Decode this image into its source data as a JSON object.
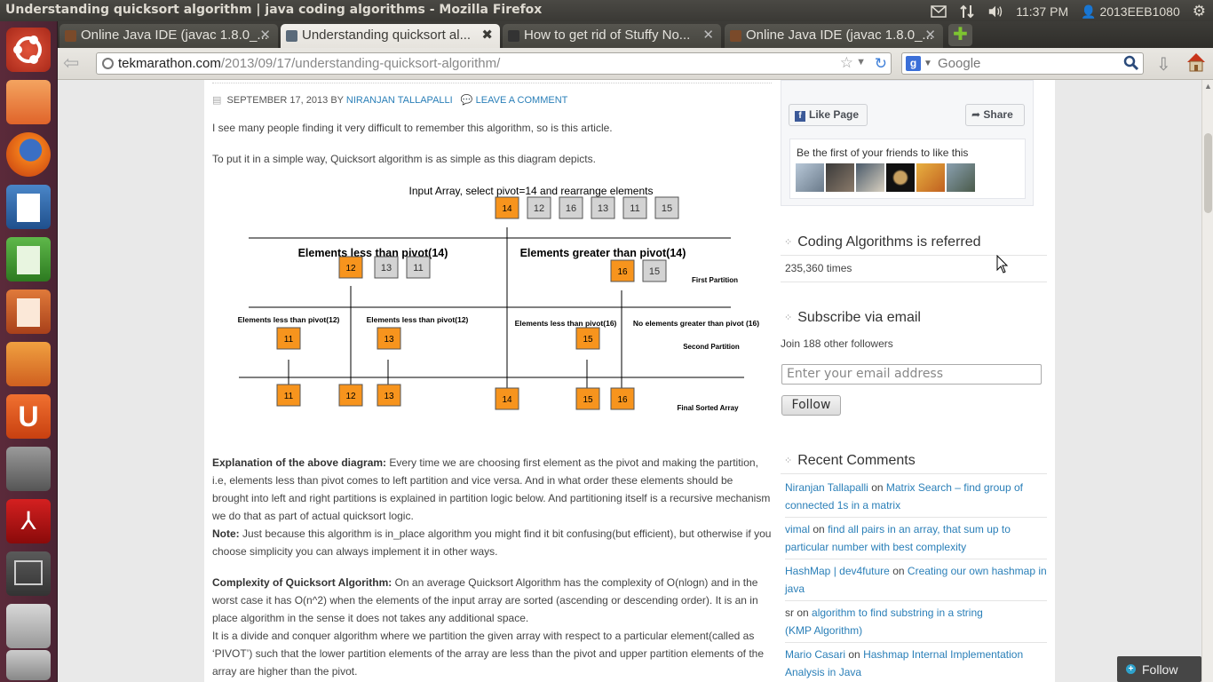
{
  "window": {
    "title": "Understanding quicksort algorithm | java coding algorithms - Mozilla Firefox"
  },
  "tray": {
    "time": "11:37 PM",
    "user": "2013EEB1080"
  },
  "tabs": [
    {
      "label": "Online Java IDE (javac 1.8.0_..."
    },
    {
      "label": "Understanding quicksort al..."
    },
    {
      "label": "How to get rid of Stuffy No..."
    },
    {
      "label": "Online Java IDE (javac 1.8.0_..."
    }
  ],
  "navbar": {
    "url_host": "tekmarathon.com",
    "url_path": "/2013/09/17/understanding-quicksort-algorithm/",
    "search_placeholder": "Google",
    "search_engine_letter": "g"
  },
  "article": {
    "date": "SEPTEMBER 17, 2013",
    "by": "BY",
    "author": "NIRANJAN TALLAPALLI",
    "comment_link": "LEAVE A COMMENT",
    "intro1": "I see many people finding it very difficult to remember this algorithm, so is this article.",
    "intro2": "To put it in a simple way, Quicksort algorithm is as simple as this diagram depicts.",
    "explanation_label": "Explanation of the above diagram:",
    "explanation_text": " Every time we are choosing first element as the pivot and making the partition, i.e, elements less than pivot comes to left partition and vice versa. And in what order these elements should be brought into left and right partitions is explained in partition logic below. And partitioning itself is a recursive mechanism we do that as part of actual quicksort logic.",
    "note_label": "Note:",
    "note_text": " Just because this algorithm is in_place algorithm you might find it bit confusing(but efficient), but otherwise if you choose simplicity you can always implement it in other ways.",
    "complexity_label": "Complexity of Quicksort Algorithm:",
    "complexity_text": " On an average Quicksort Algorithm has the complexity of O(nlogn) and in the worst case it has O(n^2) when the elements of the input array are sorted (ascending or descending order). It is an in place algorithm in the sense it does not takes any additional space.",
    "divide_text": "It is a divide and conquer algorithm where we partition the given array with respect to a particular element(called as ‘PIVOT’) such that the lower partition elements of the array are less than the pivot and upper partition elements of the array are higher than the pivot."
  },
  "diagram": {
    "title": "Input Array, select pivot=14 and rearrange elements",
    "input": [
      "14",
      "12",
      "16",
      "13",
      "11",
      "15"
    ],
    "less14": "Elements less than pivot(14)",
    "greater14": "Elements greater than pivot(14)",
    "left1": [
      "12",
      "13",
      "11"
    ],
    "right1": [
      "16",
      "15"
    ],
    "first_partition": "First Partition",
    "less12a": "Elements less than pivot(12)",
    "less12b": "Elements less than pivot(12)",
    "less16": "Elements less than pivot(16)",
    "nogreater16": "No elements greater than pivot (16)",
    "second": [
      "11",
      "13",
      "15"
    ],
    "second_partition": "Second Partition",
    "final": [
      "11",
      "12",
      "13",
      "14",
      "15",
      "16"
    ],
    "final_label": "Final Sorted Array",
    "colors": {
      "pivot": "#f7941d",
      "other": "#d3d3d3"
    }
  },
  "sidebar": {
    "fb": {
      "like": "Like Page",
      "share": "Share",
      "friends_text": "Be the first of your friends to like this"
    },
    "referred_title": "Coding Algorithms is referred",
    "referred_count": "235,360 times",
    "subscribe_title": "Subscribe via email",
    "followers": "Join 188 other followers",
    "email_placeholder": "Enter your email address",
    "follow_btn": "Follow",
    "recent_title": "Recent Comments",
    "comments": [
      {
        "author": "Niranjan Tallapalli",
        "on": "on",
        "post": "Matrix Search – find group of connected 1s in a matrix"
      },
      {
        "author": "vimal",
        "on": "on",
        "post": "find all pairs in an array, that sum up to particular number with best complexity"
      },
      {
        "author": "HashMap | dev4future",
        "on": "on",
        "post": "Creating our own hashmap in java"
      },
      {
        "author": "sr",
        "on": "on",
        "post": "algorithm to find substring in a string (KMP Algorithm)"
      },
      {
        "author": "Mario Casari",
        "on": "on",
        "post": "Hashmap Internal Implementation Analysis in Java"
      }
    ]
  },
  "wp_follow": "Follow"
}
